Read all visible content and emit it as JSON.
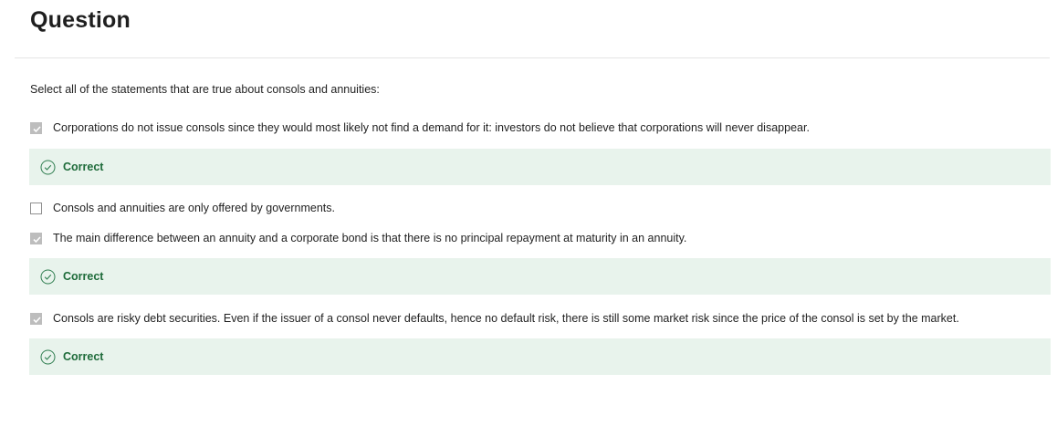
{
  "question": {
    "title": "Question",
    "prompt": "Select all of the statements that are true about consols and annuities:"
  },
  "options": [
    {
      "text": "Corporations do not issue consols since they would most likely not find a demand for it: investors do not believe that corporations will never disappear.",
      "checked": true,
      "feedback": "Correct"
    },
    {
      "text": "Consols and annuities are only offered by governments.",
      "checked": false,
      "feedback": ""
    },
    {
      "text": "The main difference between an annuity and a corporate bond is that there is no principal repayment at maturity in an annuity.",
      "checked": true,
      "feedback": "Correct"
    },
    {
      "text": "Consols are risky debt securities. Even if the issuer of a consol never defaults, hence no default risk, there is still some market risk since the price of  the consol is set by the market.",
      "checked": true,
      "feedback": "Correct"
    }
  ],
  "colors": {
    "correct_bg": "#e8f3ec",
    "correct_text": "#1e6b3a",
    "checkbox_checked": "#bdbdbd"
  },
  "icons": {
    "feedback": "check-circle-icon",
    "checkbox": "checkmark-icon"
  }
}
